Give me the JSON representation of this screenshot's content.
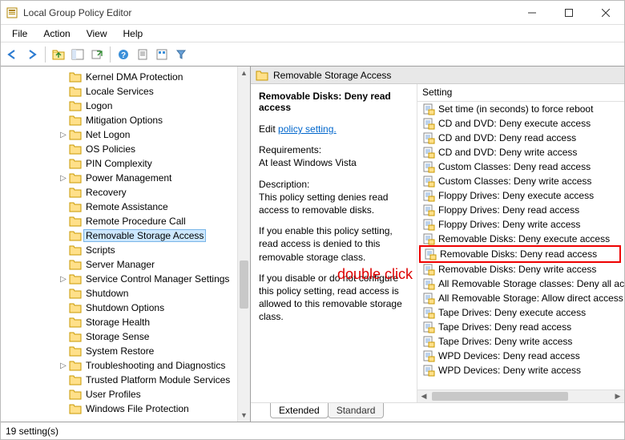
{
  "window": {
    "title": "Local Group Policy Editor"
  },
  "menu": {
    "file": "File",
    "action": "Action",
    "view": "View",
    "help": "Help"
  },
  "tree": {
    "items": [
      {
        "label": "Kernel DMA Protection",
        "expandable": false,
        "nested": false
      },
      {
        "label": "Locale Services",
        "expandable": false,
        "nested": false
      },
      {
        "label": "Logon",
        "expandable": false,
        "nested": false
      },
      {
        "label": "Mitigation Options",
        "expandable": false,
        "nested": false
      },
      {
        "label": "Net Logon",
        "expandable": true,
        "nested": false
      },
      {
        "label": "OS Policies",
        "expandable": false,
        "nested": false
      },
      {
        "label": "PIN Complexity",
        "expandable": false,
        "nested": false
      },
      {
        "label": "Power Management",
        "expandable": true,
        "nested": false
      },
      {
        "label": "Recovery",
        "expandable": false,
        "nested": false
      },
      {
        "label": "Remote Assistance",
        "expandable": false,
        "nested": false
      },
      {
        "label": "Remote Procedure Call",
        "expandable": false,
        "nested": false
      },
      {
        "label": "Removable Storage Access",
        "expandable": false,
        "nested": false,
        "selected": true
      },
      {
        "label": "Scripts",
        "expandable": false,
        "nested": false
      },
      {
        "label": "Server Manager",
        "expandable": false,
        "nested": false
      },
      {
        "label": "Service Control Manager Settings",
        "expandable": true,
        "nested": false
      },
      {
        "label": "Shutdown",
        "expandable": false,
        "nested": false
      },
      {
        "label": "Shutdown Options",
        "expandable": false,
        "nested": false
      },
      {
        "label": "Storage Health",
        "expandable": false,
        "nested": false
      },
      {
        "label": "Storage Sense",
        "expandable": false,
        "nested": false
      },
      {
        "label": "System Restore",
        "expandable": false,
        "nested": false
      },
      {
        "label": "Troubleshooting and Diagnostics",
        "expandable": true,
        "nested": false
      },
      {
        "label": "Trusted Platform Module Services",
        "expandable": false,
        "nested": false
      },
      {
        "label": "User Profiles",
        "expandable": false,
        "nested": false
      },
      {
        "label": "Windows File Protection",
        "expandable": false,
        "nested": false
      }
    ]
  },
  "category": {
    "title": "Removable Storage Access"
  },
  "detail": {
    "heading": "Removable Disks: Deny read access",
    "edit_prefix": "Edit ",
    "edit_link": "policy setting.",
    "req_label": "Requirements:",
    "req_value": "At least Windows Vista",
    "desc_label": "Description:",
    "desc_value": "This policy setting denies read access to removable disks.",
    "enable_text": "If you enable this policy setting, read access is denied to this removable storage class.",
    "disable_text": "If you disable or do not configure this policy setting, read access is allowed to this removable storage class."
  },
  "annotation": {
    "text": "double click"
  },
  "settings": {
    "header": "Setting",
    "items": [
      "Set time (in seconds) to force reboot",
      "CD and DVD: Deny execute access",
      "CD and DVD: Deny read access",
      "CD and DVD: Deny write access",
      "Custom Classes: Deny read access",
      "Custom Classes: Deny write access",
      "Floppy Drives: Deny execute access",
      "Floppy Drives: Deny read access",
      "Floppy Drives: Deny write access",
      "Removable Disks: Deny execute access",
      "Removable Disks: Deny read access",
      "Removable Disks: Deny write access",
      "All Removable Storage classes: Deny all access",
      "All Removable Storage: Allow direct access in remote sessions",
      "Tape Drives: Deny execute access",
      "Tape Drives: Deny read access",
      "Tape Drives: Deny write access",
      "WPD Devices: Deny read access",
      "WPD Devices: Deny write access"
    ],
    "highlighted_index": 10
  },
  "tabs": {
    "extended": "Extended",
    "standard": "Standard"
  },
  "status": {
    "text": "19 setting(s)"
  }
}
